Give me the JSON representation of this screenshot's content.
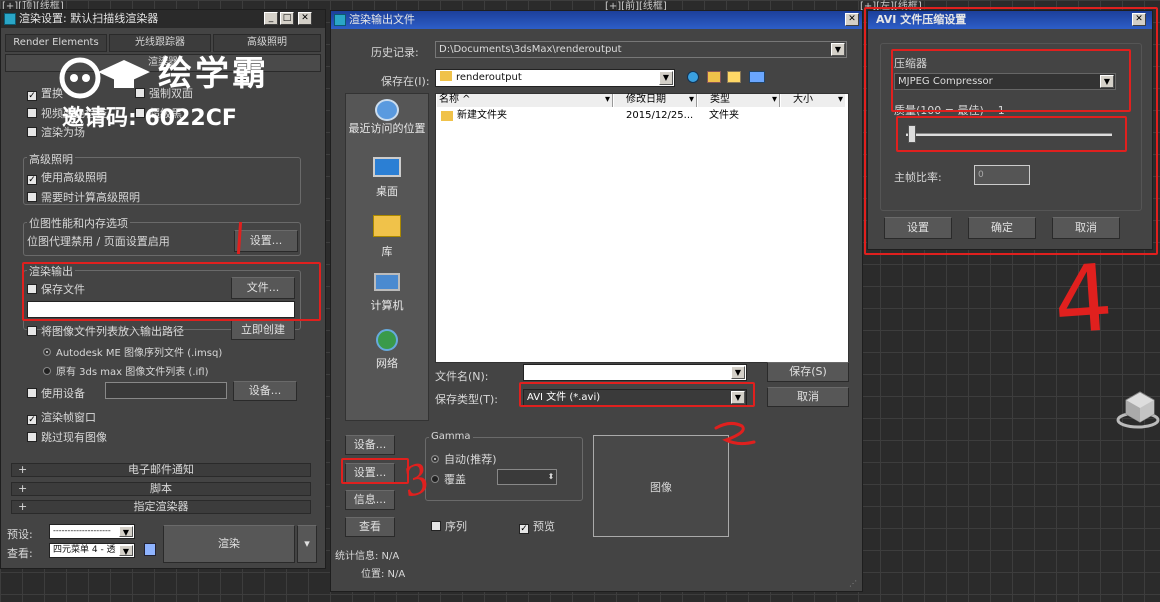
{
  "colors": {
    "annotation": "#e0201e",
    "title_bar_active": "#2d5ec8"
  },
  "viewport": {
    "top_labels": [
      "[+][顶][线框]",
      "[+][前][线框]",
      "[+][左][线框]"
    ]
  },
  "watermark": {
    "brand": "绘学霸",
    "invite": "邀请码: 6022CF"
  },
  "render_setup": {
    "title": "渲染设置: 默认扫描线渲染器",
    "tabs": [
      "Render Elements",
      "光线跟踪器",
      "高级照明"
    ],
    "tab_row2": "渲染器",
    "options": [
      "置换",
      "强制双面",
      "视频颜色检查",
      "超级黑",
      "渲染为场"
    ],
    "adv_light": {
      "label": "高级照明",
      "use": "使用高级照明",
      "compute": "需要时计算高级照明"
    },
    "bitmap": {
      "label": "位图性能和内存选项",
      "status": "位图代理禁用 / 页面设置启用",
      "button": "设置..."
    },
    "render_output": {
      "label": "渲染输出",
      "save_file": "保存文件",
      "files_button": "文件..."
    },
    "imglist": {
      "label": "将图像文件列表放入输出路径",
      "create": "立即创建",
      "opt1": "Autodesk ME 图像序列文件 (.imsq)",
      "opt2": "原有 3ds max 图像文件列表 (.ifl)"
    },
    "device": {
      "label": "使用设备",
      "button": "设备..."
    },
    "frame_window": "渲染帧窗口",
    "skip": "跳过现有图像",
    "rollouts": [
      "电子邮件通知",
      "脚本",
      "指定渲染器"
    ],
    "preset_label": "预设:",
    "preset_value": "--------------------",
    "view_label": "查看:",
    "view_value": "四元菜单 4 - 透",
    "render_button": "渲染"
  },
  "file_dialog": {
    "title": "渲染输出文件",
    "history_label": "历史记录:",
    "history_value": "D:\\Documents\\3dsMax\\renderoutput",
    "savein_label": "保存在(I):",
    "savein_value": "renderoutput",
    "places": [
      "最近访问的位置",
      "桌面",
      "库",
      "计算机",
      "网络"
    ],
    "columns": [
      "名称",
      "修改日期",
      "类型",
      "大小"
    ],
    "rows": [
      {
        "name": "新建文件夹",
        "date": "2015/12/25...",
        "type": "文件夹",
        "size": ""
      }
    ],
    "filename_label": "文件名(N):",
    "filename_value": "",
    "filetype_label": "保存类型(T):",
    "filetype_value": "AVI 文件 (*.avi)",
    "save_button": "保存(S)",
    "cancel_button": "取消",
    "left_buttons": [
      "设备...",
      "设置...",
      "信息...",
      "查看"
    ],
    "gamma": {
      "label": "Gamma",
      "auto": "自动(推荐)",
      "override": "覆盖"
    },
    "image_label": "图像",
    "sequence": "序列",
    "preview": "预览",
    "stats": "统计信息: N/A",
    "location": "位置: N/A"
  },
  "avi_dialog": {
    "title": "AVI 文件压缩设置",
    "compressor_label": "压缩器",
    "compressor_value": "MJPEG Compressor",
    "quality_label": "质量(100 = 最佳)",
    "quality_value": "1",
    "quality_fraction": 0.01,
    "keyframe_label": "主帧比率:",
    "keyframe_value": "0",
    "buttons": [
      "设置",
      "确定",
      "取消"
    ]
  },
  "annotations": {
    "step3": "3",
    "step4": "4"
  }
}
